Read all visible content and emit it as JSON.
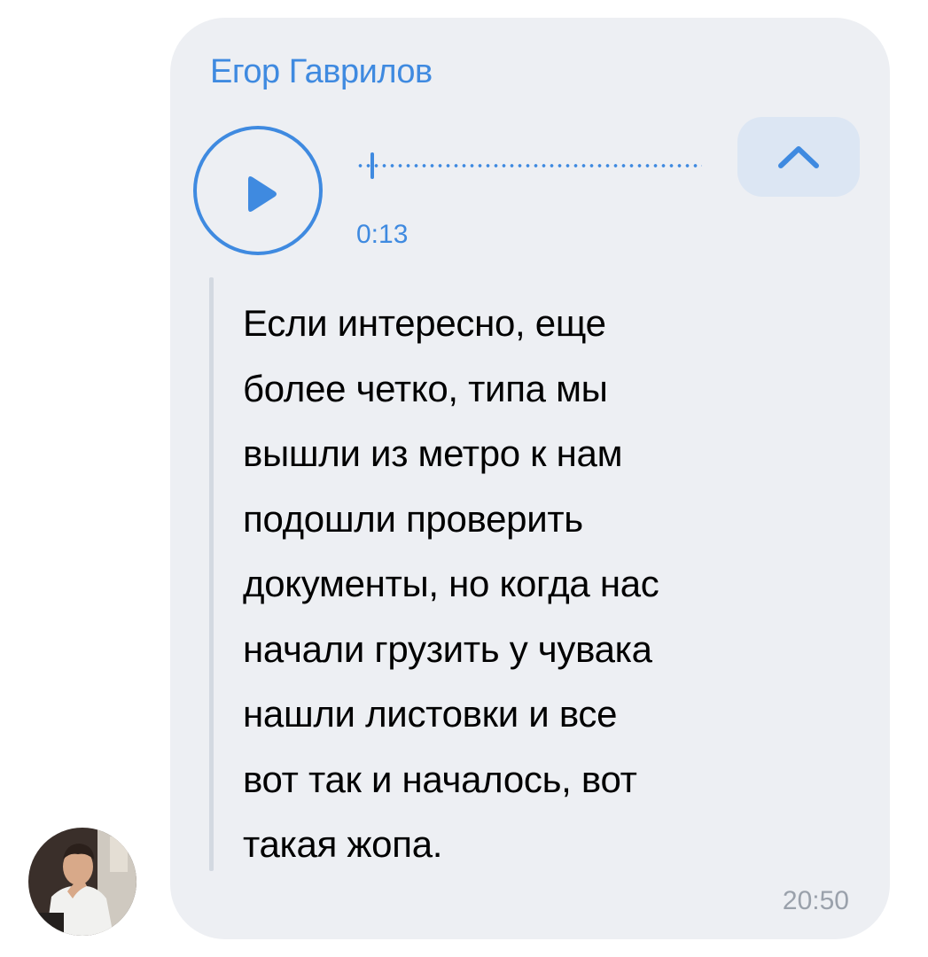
{
  "message": {
    "sender_name": "Егор Гаврилов",
    "audio": {
      "duration": "0:13",
      "play_icon": "play-icon",
      "collapse_icon": "chevron-up-icon",
      "progress": 0.02
    },
    "transcript_lines": [
      "Если интересно, еще",
      "более четко, типа мы",
      "вышли из метро к нам",
      "подошли проверить",
      "документы, но когда нас",
      "начали грузить у чувака",
      "нашли листовки и все",
      "вот так и началось, вот",
      "такая жопа."
    ],
    "time": "20:50"
  },
  "colors": {
    "accent": "#3f8ae0",
    "bubble_background": "#edeff3",
    "collapse_button_background": "#dce6f3",
    "timestamp": "#9aa1ab"
  }
}
